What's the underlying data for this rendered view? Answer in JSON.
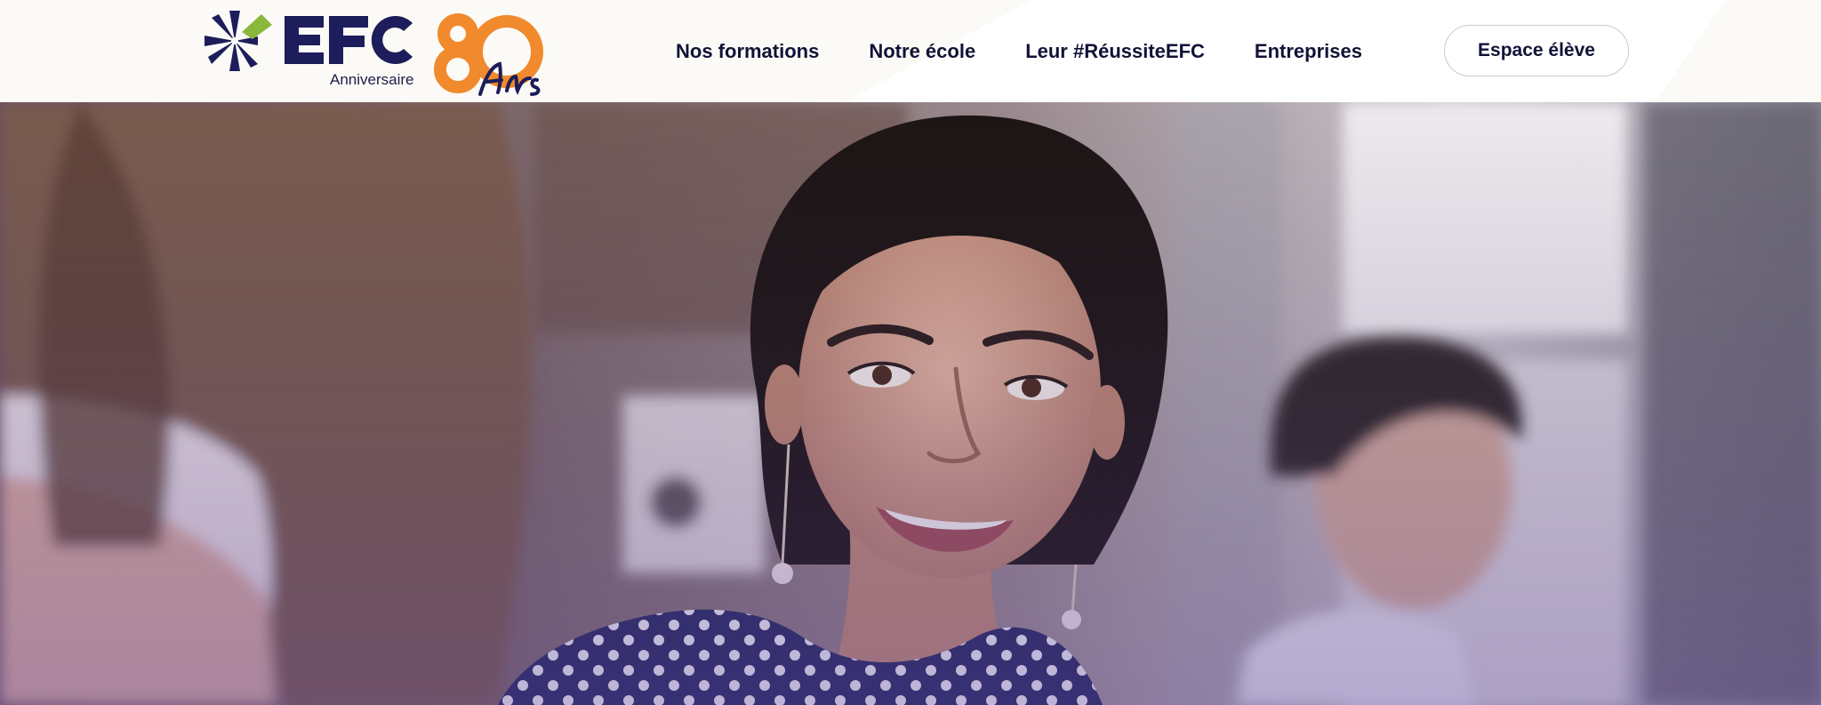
{
  "brand": {
    "name": "EFC",
    "subtitle": "Anniversaire",
    "anniversary_number": "80",
    "anniversary_word": "Ans",
    "colors": {
      "navy": "#1c1d5a",
      "orange": "#f08a2c",
      "green": "#8ab83a"
    }
  },
  "nav": {
    "items": [
      {
        "label": "Nos formations"
      },
      {
        "label": "Notre école"
      },
      {
        "label": "Leur #RéussiteEFC"
      },
      {
        "label": "Entreprises"
      }
    ],
    "cta_label": "Espace élève"
  },
  "hero": {
    "image": "photo-smiling-student"
  }
}
